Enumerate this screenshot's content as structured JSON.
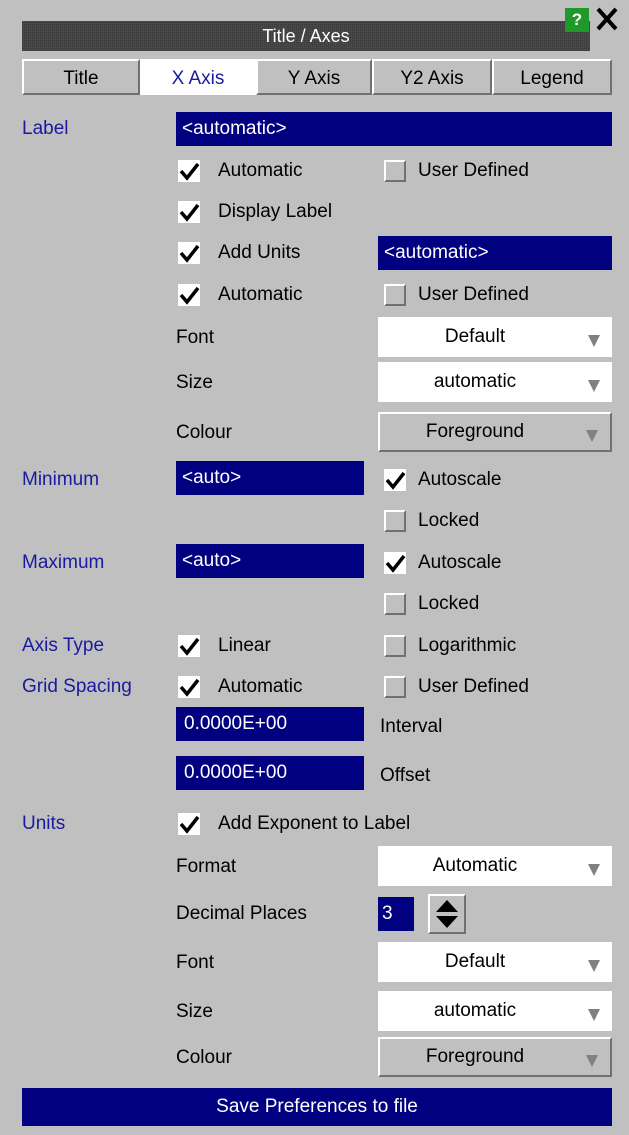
{
  "window": {
    "title": "Title / Axes",
    "help_label": "?",
    "close_label": "✕"
  },
  "tabs": [
    "Title",
    "X Axis",
    "Y Axis",
    "Y2 Axis",
    "Legend"
  ],
  "active_tab": "X Axis",
  "label_section": {
    "heading": "Label",
    "value": "<automatic>",
    "automatic": {
      "label": "Automatic",
      "checked": true
    },
    "user_defined": {
      "label": "User Defined",
      "checked": false
    },
    "display_label": {
      "label": "Display Label",
      "checked": true
    },
    "add_units": {
      "label": "Add Units",
      "checked": true,
      "value": "<automatic>"
    },
    "units_automatic": {
      "label": "Automatic",
      "checked": true
    },
    "units_user_defined": {
      "label": "User Defined",
      "checked": false
    },
    "font": {
      "label": "Font",
      "value": "Default"
    },
    "size": {
      "label": "Size",
      "value": "automatic"
    },
    "colour": {
      "label": "Colour",
      "value": "Foreground"
    }
  },
  "minimum": {
    "heading": "Minimum",
    "value": "<auto>",
    "autoscale": {
      "label": "Autoscale",
      "checked": true
    },
    "locked": {
      "label": "Locked",
      "checked": false
    }
  },
  "maximum": {
    "heading": "Maximum",
    "value": "<auto>",
    "autoscale": {
      "label": "Autoscale",
      "checked": true
    },
    "locked": {
      "label": "Locked",
      "checked": false
    }
  },
  "axis_type": {
    "heading": "Axis Type",
    "linear": {
      "label": "Linear",
      "checked": true
    },
    "logarithmic": {
      "label": "Logarithmic",
      "checked": false
    }
  },
  "grid_spacing": {
    "heading": "Grid Spacing",
    "automatic": {
      "label": "Automatic",
      "checked": true
    },
    "user_defined": {
      "label": "User Defined",
      "checked": false
    },
    "interval": {
      "value": "0.0000E+00",
      "label": "Interval"
    },
    "offset": {
      "value": "0.0000E+00",
      "label": "Offset"
    }
  },
  "units": {
    "heading": "Units",
    "add_exponent": {
      "label": "Add Exponent to Label",
      "checked": true
    },
    "format": {
      "label": "Format",
      "value": "Automatic"
    },
    "decimal_places": {
      "label": "Decimal Places",
      "value": "3"
    },
    "font": {
      "label": "Font",
      "value": "Default"
    },
    "size": {
      "label": "Size",
      "value": "automatic"
    },
    "colour": {
      "label": "Colour",
      "value": "Foreground"
    }
  },
  "save_button": "Save Preferences to file",
  "colors": {
    "field_bg": "#000080",
    "panel_bg": "#c0c0c0",
    "heading_text": "#1a1aa0",
    "title_bg": "#4c4c4c"
  }
}
